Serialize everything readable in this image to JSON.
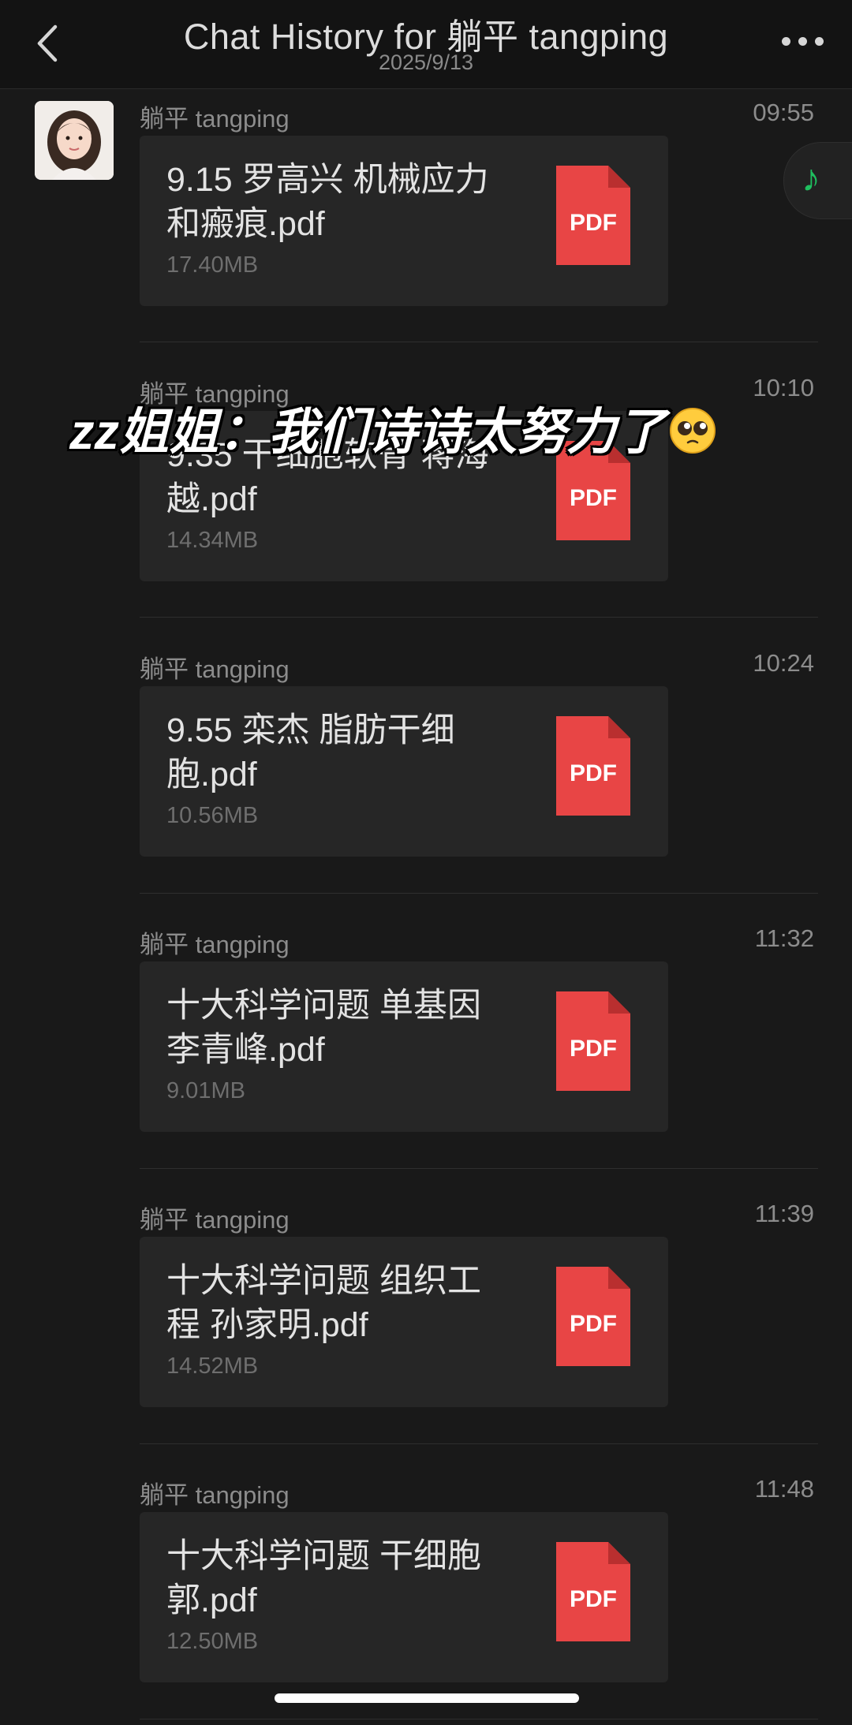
{
  "header": {
    "title": "Chat History for 躺平 tangping",
    "date": "2025/9/13"
  },
  "overlay_caption": "zz姐姐：我们诗诗太努力了",
  "pdf_label": "PDF",
  "messages": [
    {
      "sender": "躺平 tangping",
      "time": "09:55",
      "filename": "9.15 罗高兴 机械应力和瘢痕.pdf",
      "size": "17.40MB"
    },
    {
      "sender": "躺平 tangping",
      "time": "10:10",
      "filename": "9.35 干细胞软骨 蒋海越.pdf",
      "size": "14.34MB"
    },
    {
      "sender": "躺平 tangping",
      "time": "10:24",
      "filename": "9.55 栾杰 脂肪干细胞.pdf",
      "size": "10.56MB"
    },
    {
      "sender": "躺平 tangping",
      "time": "11:32",
      "filename": "十大科学问题 单基因 李青峰.pdf",
      "size": "9.01MB"
    },
    {
      "sender": "躺平 tangping",
      "time": "11:39",
      "filename": "十大科学问题 组织工程 孙家明.pdf",
      "size": "14.52MB"
    },
    {
      "sender": "躺平 tangping",
      "time": "11:48",
      "filename": "十大科学问题 干细胞郭.pdf",
      "size": "12.50MB"
    }
  ],
  "colors": {
    "background": "#191919",
    "card": "#262626",
    "pdf_red": "#e84545",
    "music_green": "#1fbf5f"
  }
}
